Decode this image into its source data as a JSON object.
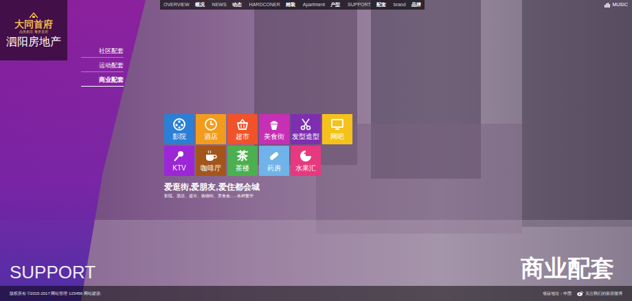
{
  "logo": {
    "title": "大同首府",
    "tagline": "品质典范 尊贵首府",
    "subtitle": "泗阳房地产"
  },
  "nav": [
    {
      "en": "OVERVIEW",
      "zh": "概况"
    },
    {
      "en": "NEWS",
      "zh": "动态"
    },
    {
      "en": "HARDCONER",
      "zh": "精装"
    },
    {
      "en": "Apartment",
      "zh": "户型"
    },
    {
      "en": "SUPPORT",
      "zh": "配套"
    },
    {
      "en": "brand",
      "zh": "品牌"
    }
  ],
  "music": {
    "label": "MUSIC"
  },
  "side_menu": [
    {
      "label": "社区配套",
      "selected": false
    },
    {
      "label": "运动配套",
      "selected": false
    },
    {
      "label": "商业配套",
      "selected": true
    }
  ],
  "tiles": [
    {
      "label": "影院",
      "color": "#2b7fd4"
    },
    {
      "label": "酒店",
      "color": "#f29b1d"
    },
    {
      "label": "超市",
      "color": "#f0522a"
    },
    {
      "label": "美食街",
      "color": "#c72fb5"
    },
    {
      "label": "发型造型",
      "color": "#7d2fb0"
    },
    {
      "label": "网吧",
      "color": "#f5c21b"
    },
    {
      "label": "KTV",
      "color": "#9b27d6"
    },
    {
      "label": "咖啡厅",
      "color": "#a3561b"
    },
    {
      "label": "茶楼",
      "color": "#4caf50",
      "glyph": "茶"
    },
    {
      "label": "药房",
      "color": "#6fb3e8"
    },
    {
      "label": "水果汇",
      "color": "#e6397f"
    }
  ],
  "slogan": {
    "title": "爱逛街,爱朋友,爱住都会城",
    "subtitle": "影院、酒店、超市、购物街、美食会......各种繁华"
  },
  "section": {
    "en": "SUPPORT",
    "zh": "商业配套"
  },
  "footer": {
    "copyright": "版权所有 ©2015-2017 网站管理 123456 网站建设:",
    "address": "项目地址：中国",
    "weibo": "关注我们的新浪微博"
  }
}
